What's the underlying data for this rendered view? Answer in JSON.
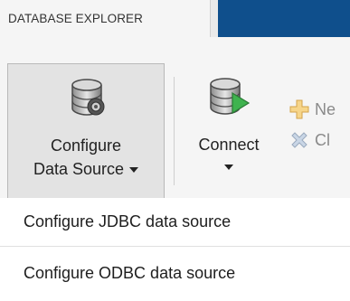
{
  "tabs": {
    "active_label": "DATABASE EXPLORER"
  },
  "ribbon": {
    "configure": {
      "line1": "Configure",
      "line2": "Data Source",
      "icon": "database-gear-icon"
    },
    "connect": {
      "label": "Connect",
      "icon": "database-play-icon"
    },
    "new_button": {
      "label": "Ne",
      "icon": "plus-icon"
    },
    "close_button": {
      "label": "Cl",
      "icon": "close-x-icon"
    }
  },
  "menu": {
    "items": [
      {
        "label": "Configure JDBC data source"
      },
      {
        "label": "Configure ODBC data source"
      }
    ]
  }
}
